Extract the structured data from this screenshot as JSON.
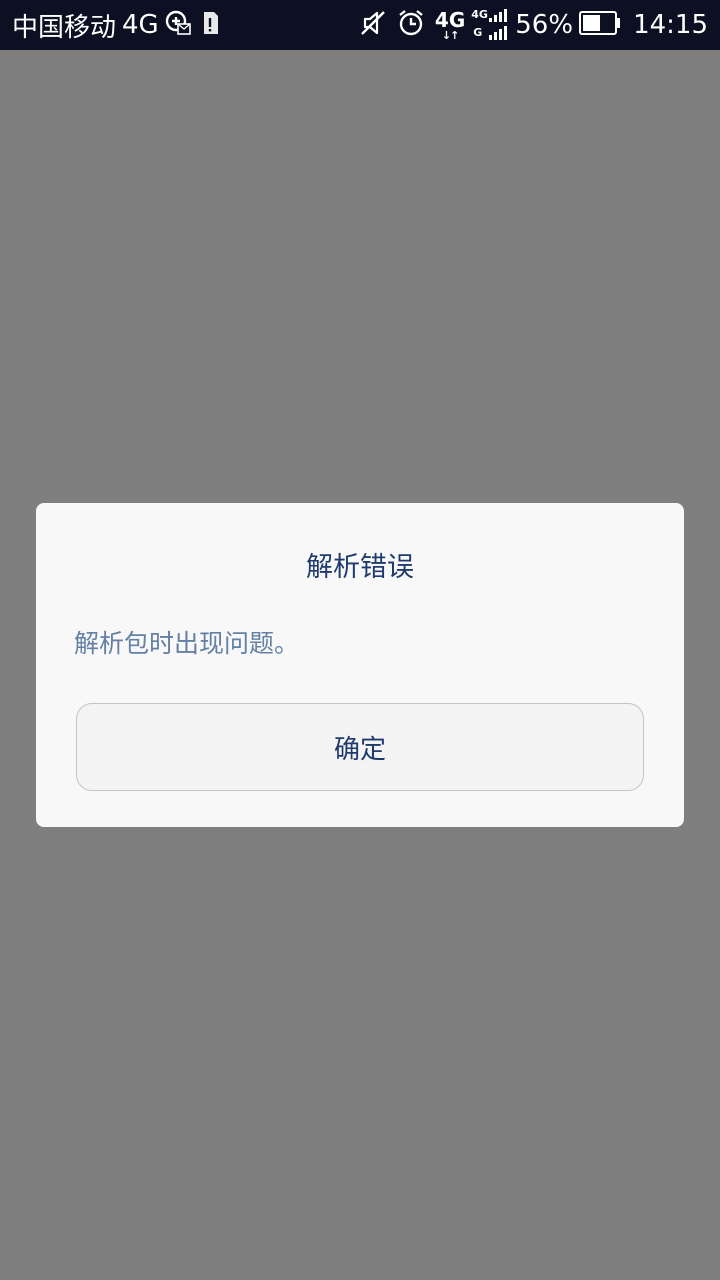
{
  "status_bar": {
    "carrier": "中国移动",
    "network_type": "4G",
    "secondary_network_top": "4G",
    "sim2_top": "4G",
    "sim2_bottom": "G",
    "battery_percent": "56%",
    "battery_level": 0.56,
    "time": "14:15",
    "icons": [
      "volte-hd-icon",
      "sd-card-alert-icon",
      "vibrate-silent-icon",
      "alarm-icon",
      "data-arrows-icon",
      "signal-icon",
      "battery-icon"
    ]
  },
  "dialog": {
    "title": "解析错误",
    "message": "解析包时出现问题。",
    "ok_label": "确定"
  },
  "colors": {
    "status_bar_bg": "#0c1022",
    "scrim": "#7f7f7f",
    "dialog_bg": "#f8f8f8",
    "title_text": "#1f3b6e",
    "message_text": "#6480a6"
  }
}
